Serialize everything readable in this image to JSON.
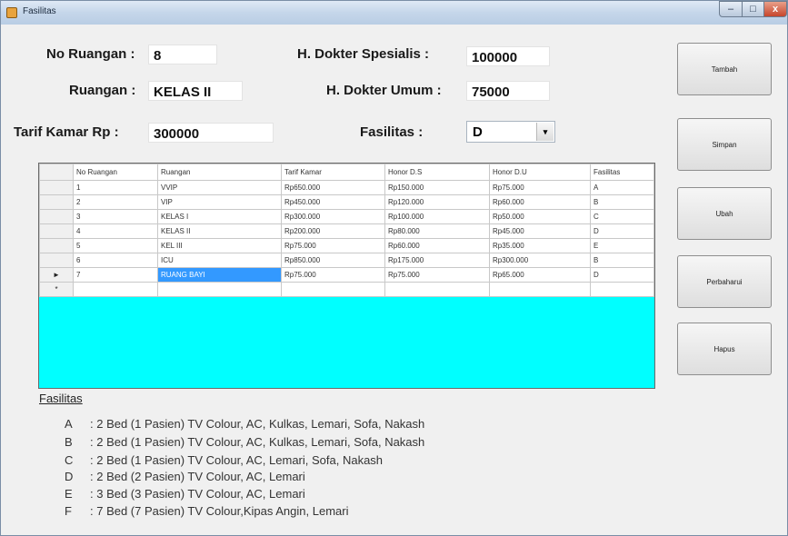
{
  "window": {
    "title": "Fasilitas",
    "controls": {
      "minimize": "–",
      "maximize": "□",
      "close": "x"
    }
  },
  "form": {
    "no_ruangan_label": "No Ruangan :",
    "no_ruangan_value": "8",
    "ruangan_label": "Ruangan :",
    "ruangan_value": "KELAS II",
    "tarif_label": "Tarif Kamar Rp :",
    "tarif_value": "300000",
    "h_dokter_spesialis_label": "H. Dokter Spesialis :",
    "h_dokter_spesialis_value": "100000",
    "h_dokter_umum_label": "H. Dokter Umum :",
    "h_dokter_umum_value": "75000",
    "fasilitas_label": "Fasilitas :",
    "fasilitas_value": "D",
    "combo_arrow": "▾"
  },
  "buttons": {
    "tambah": "Tambah",
    "simpan": "Simpan",
    "ubah": "Ubah",
    "perbaharui": "Perbaharui",
    "hapus": "Hapus"
  },
  "grid": {
    "columns": [
      "No Ruangan",
      "Ruangan",
      "Tarif Kamar",
      "Honor D.S",
      "Honor D.U",
      "Fasilitas"
    ],
    "rows": [
      [
        "1",
        "VVIP",
        "Rp650.000",
        "Rp150.000",
        "Rp75.000",
        "A"
      ],
      [
        "2",
        "VIP",
        "Rp450.000",
        "Rp120.000",
        "Rp60.000",
        "B"
      ],
      [
        "3",
        "KELAS I",
        "Rp300.000",
        "Rp100.000",
        "Rp50.000",
        "C"
      ],
      [
        "4",
        "KELAS II",
        "Rp200.000",
        "Rp80.000",
        "Rp45.000",
        "D"
      ],
      [
        "5",
        "KEL III",
        "Rp75.000",
        "Rp60.000",
        "Rp35.000",
        "E"
      ],
      [
        "6",
        "ICU",
        "Rp850.000",
        "Rp175.000",
        "Rp300.000",
        "B"
      ],
      [
        "7",
        "RUANG BAYI",
        "Rp75.000",
        "Rp75.000",
        "Rp65.000",
        "D"
      ]
    ],
    "current_row_indicator": "►",
    "new_row_indicator": "*"
  },
  "legend": {
    "title": "Fasilitas",
    "items": [
      {
        "key": "A",
        "text": ": 2 Bed (1 Pasien) TV Colour, AC, Kulkas, Lemari, Sofa, Nakash"
      },
      {
        "key": "B",
        "text": ": 2 Bed (1 Pasien) TV Colour, AC, Kulkas, Lemari, Sofa, Nakash"
      },
      {
        "key": "C",
        "text": ": 2 Bed (1 Pasien) TV Colour, AC, Lemari, Sofa, Nakash"
      },
      {
        "key": "D",
        "text": ": 2 Bed (2 Pasien) TV Colour, AC, Lemari"
      },
      {
        "key": "E",
        "text": ": 3 Bed (3 Pasien) TV Colour, AC, Lemari"
      },
      {
        "key": "F",
        "text": ": 7 Bed (7 Pasien) TV Colour,Kipas Angin, Lemari"
      }
    ]
  }
}
